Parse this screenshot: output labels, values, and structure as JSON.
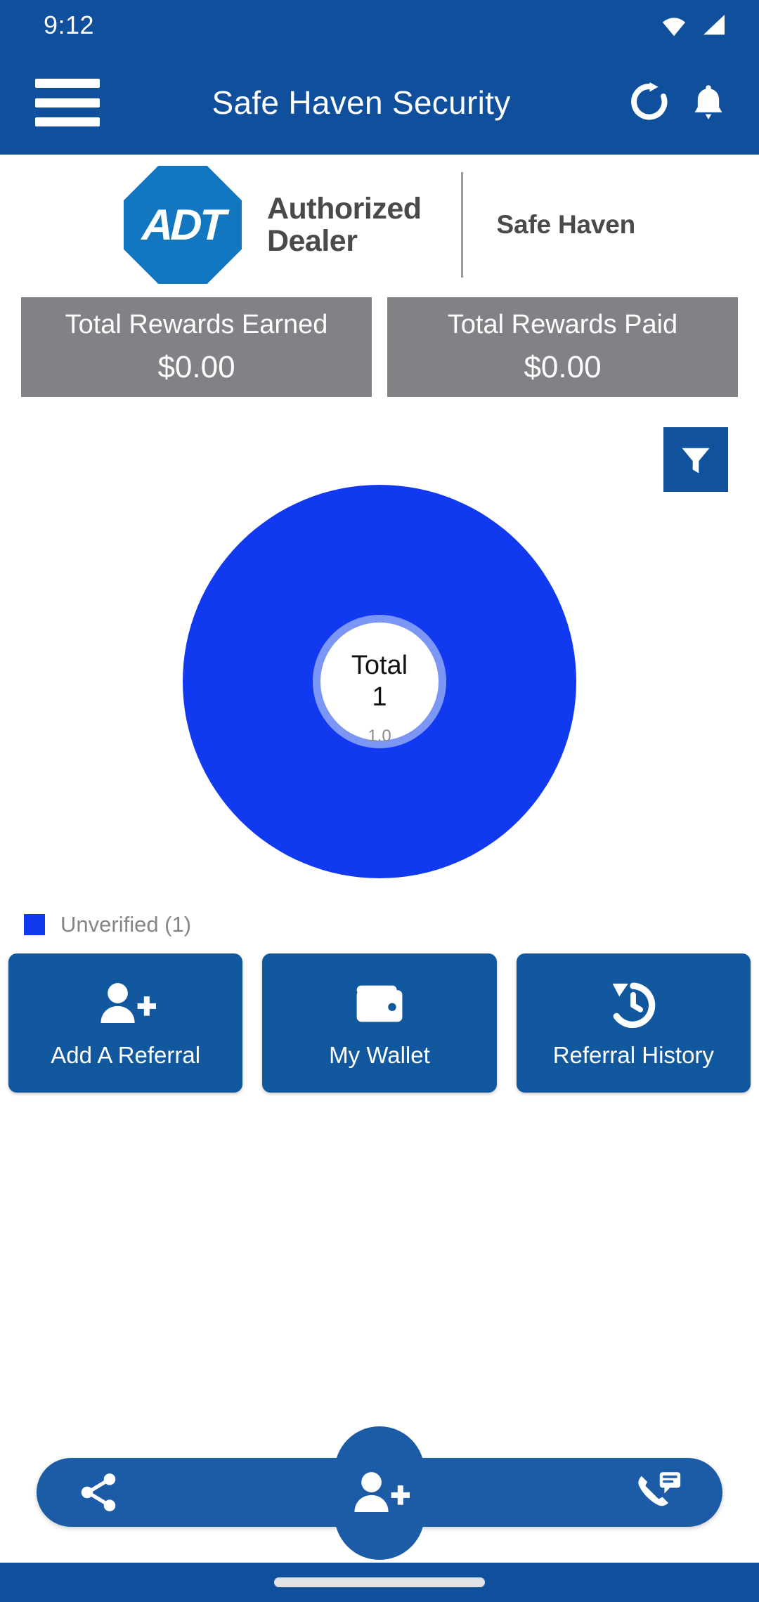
{
  "statusbar": {
    "time": "9:12",
    "wifi_icon": "wifi-icon",
    "signal_icon": "cellular-signal-icon"
  },
  "appbar": {
    "menu_icon": "hamburger-menu-icon",
    "title": "Safe Haven Security",
    "refresh_icon": "refresh-icon",
    "notification_icon": "bell-icon"
  },
  "banner": {
    "logo_text": "ADT",
    "authorized_line1": "Authorized",
    "authorized_line2": "Dealer",
    "partner": "Safe Haven"
  },
  "rewards": [
    {
      "title": "Total Rewards Earned",
      "value": "$0.00"
    },
    {
      "title": "Total Rewards Paid",
      "value": "$0.00"
    }
  ],
  "filter": {
    "icon": "filter-funnel-icon"
  },
  "chart_data": {
    "type": "pie",
    "title": "",
    "categories": [
      "Unverified"
    ],
    "values": [
      1.0
    ],
    "data_labels": [
      "1.0"
    ],
    "colors": [
      "#1139EF"
    ],
    "center_label": "Total",
    "center_value": "1",
    "legend": [
      {
        "label": "Unverified (1)",
        "color": "#1139EF",
        "value": 1
      }
    ],
    "legend_position": "bottom-left",
    "donut": true
  },
  "actions": [
    {
      "label": "Add A Referral",
      "icon": "person-add-icon"
    },
    {
      "label": "My Wallet",
      "icon": "wallet-icon"
    },
    {
      "label": "Referral History",
      "icon": "history-clock-icon"
    }
  ],
  "bottomnav": {
    "share_icon": "share-icon",
    "fab_icon": "person-add-icon",
    "contact_icon": "phone-message-icon"
  },
  "gesture": {
    "handle": "home-gesture-handle"
  },
  "colors": {
    "primary": "#0F4F9B",
    "action": "#11589F",
    "chart_blue": "#1139EF",
    "card_gray": "#808285",
    "adt_blue": "#1277C0"
  }
}
